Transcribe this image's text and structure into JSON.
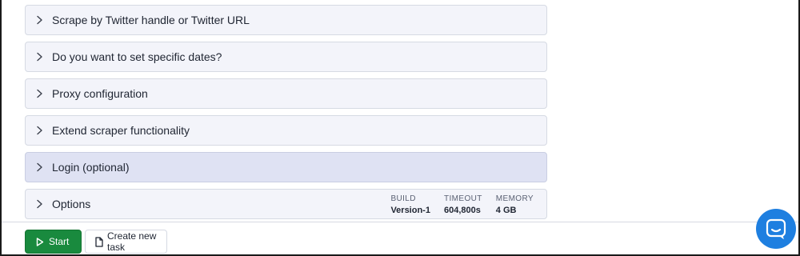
{
  "sections": [
    {
      "label": "Scrape by Twitter handle or Twitter URL"
    },
    {
      "label": "Do you want to set specific dates?"
    },
    {
      "label": "Proxy configuration"
    },
    {
      "label": "Extend scraper functionality"
    },
    {
      "label": "Login (optional)"
    },
    {
      "label": "Options"
    }
  ],
  "options_meta": {
    "build_label": "BUILD",
    "build_value": "Version-1",
    "timeout_label": "TIMEOUT",
    "timeout_value": "604,800s",
    "memory_label": "MEMORY",
    "memory_value": "4 GB"
  },
  "footer": {
    "start_label": "Start",
    "new_task_label": "Create new task"
  },
  "icons": {
    "chevron": "chevron-right-icon",
    "play": "play-icon",
    "document": "document-icon",
    "chat": "chat-bubble-icon"
  },
  "colors": {
    "start_button": "#198a3e",
    "chat_button": "#1e7fe0",
    "section_bg": "#f3f4fa",
    "section_highlight_bg": "#dfe2f3"
  }
}
